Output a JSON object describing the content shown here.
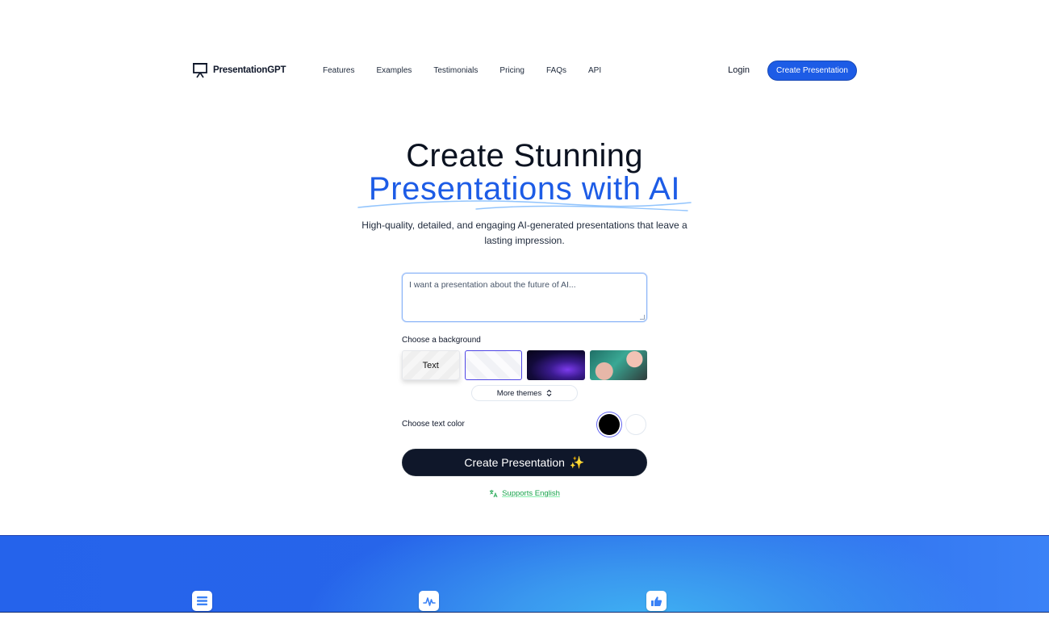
{
  "nav": {
    "logo_text": "PresentationGPT",
    "links": [
      "Features",
      "Examples",
      "Testimonials",
      "Pricing",
      "FAQs",
      "API"
    ],
    "login": "Login",
    "cta": "Create Presentation"
  },
  "hero": {
    "title_line1": "Create Stunning",
    "title_line2": "Presentations with AI",
    "subtitle": "High-quality, detailed, and engaging AI-generated presentations that leave a lasting impression."
  },
  "form": {
    "prompt_placeholder": "I want a presentation about the future of AI...",
    "background_label": "Choose a background",
    "theme_text_label": "Text",
    "more_themes": "More themes",
    "text_color_label": "Choose text color",
    "colors": [
      "#000000",
      "#ffffff"
    ],
    "create_button": "Create Presentation",
    "sparkle": "✨",
    "supports": "Supports English"
  },
  "colors": {
    "accent": "#1d5ce6",
    "dark_button": "#0f172a",
    "supports_green": "#16a34a"
  },
  "band_icons": [
    "list-icon",
    "waveform-icon",
    "thumbs-up-icon"
  ]
}
